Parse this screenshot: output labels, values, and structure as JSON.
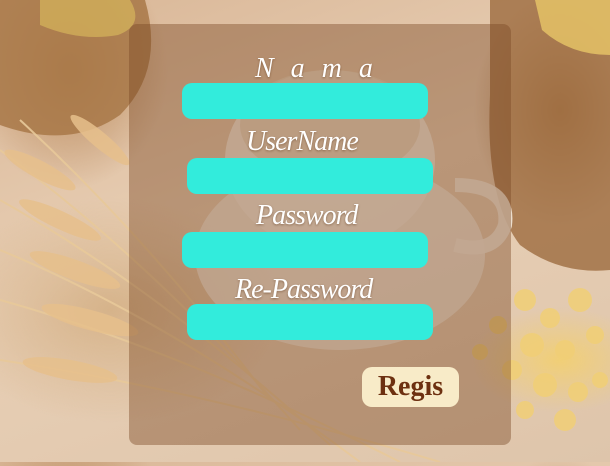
{
  "form": {
    "fields": [
      {
        "label": "N a m a",
        "value": "",
        "placeholder": ""
      },
      {
        "label": "UserName",
        "value": "",
        "placeholder": ""
      },
      {
        "label": "Password",
        "value": "",
        "placeholder": ""
      },
      {
        "label": "Re-Password",
        "value": "",
        "placeholder": ""
      }
    ],
    "submit_label": "Regis"
  },
  "colors": {
    "field_background": "#32ecdc",
    "button_background": "#f8ebc8",
    "button_text": "#6d3010",
    "panel_overlay": "#794823"
  }
}
